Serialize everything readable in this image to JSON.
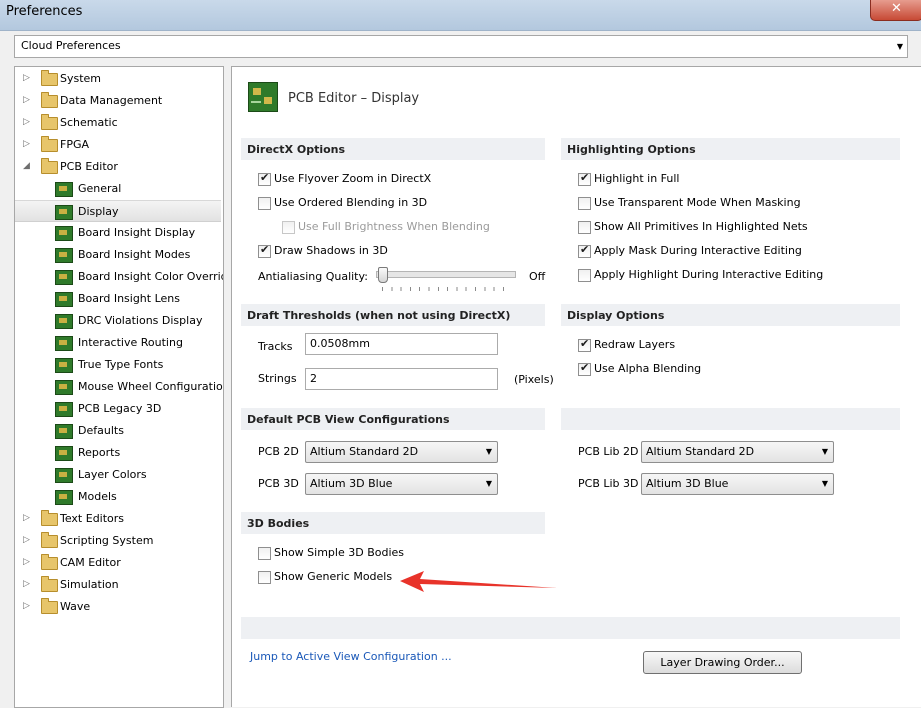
{
  "window": {
    "title": "Preferences",
    "close": "✕"
  },
  "cloud": {
    "value": "Cloud Preferences",
    "arrow": "▼"
  },
  "tree": [
    {
      "label": "System",
      "kind": "folder",
      "level": 0,
      "expanded": false,
      "selected": false
    },
    {
      "label": "Data Management",
      "kind": "folder",
      "level": 0,
      "expanded": false,
      "selected": false
    },
    {
      "label": "Schematic",
      "kind": "folder",
      "level": 0,
      "expanded": false,
      "selected": false
    },
    {
      "label": "FPGA",
      "kind": "folder",
      "level": 0,
      "expanded": false,
      "selected": false
    },
    {
      "label": "PCB Editor",
      "kind": "folder",
      "level": 0,
      "expanded": true,
      "selected": false
    },
    {
      "label": "General",
      "kind": "pcb",
      "level": 1,
      "selected": false
    },
    {
      "label": "Display",
      "kind": "pcb",
      "level": 1,
      "selected": true
    },
    {
      "label": "Board Insight Display",
      "kind": "pcb",
      "level": 1,
      "selected": false
    },
    {
      "label": "Board Insight Modes",
      "kind": "pcb",
      "level": 1,
      "selected": false
    },
    {
      "label": "Board Insight Color Overrid",
      "kind": "pcb",
      "level": 1,
      "selected": false
    },
    {
      "label": "Board Insight Lens",
      "kind": "pcb",
      "level": 1,
      "selected": false
    },
    {
      "label": "DRC Violations Display",
      "kind": "pcb",
      "level": 1,
      "selected": false
    },
    {
      "label": "Interactive Routing",
      "kind": "pcb",
      "level": 1,
      "selected": false
    },
    {
      "label": "True Type Fonts",
      "kind": "pcb",
      "level": 1,
      "selected": false
    },
    {
      "label": "Mouse Wheel Configuration",
      "kind": "pcb",
      "level": 1,
      "selected": false
    },
    {
      "label": "PCB Legacy 3D",
      "kind": "pcb",
      "level": 1,
      "selected": false
    },
    {
      "label": "Defaults",
      "kind": "pcb",
      "level": 1,
      "selected": false
    },
    {
      "label": "Reports",
      "kind": "pcb",
      "level": 1,
      "selected": false
    },
    {
      "label": "Layer Colors",
      "kind": "pcb",
      "level": 1,
      "selected": false
    },
    {
      "label": "Models",
      "kind": "pcb",
      "level": 1,
      "selected": false
    },
    {
      "label": "Text Editors",
      "kind": "folder",
      "level": 0,
      "expanded": false,
      "selected": false
    },
    {
      "label": "Scripting System",
      "kind": "folder",
      "level": 0,
      "expanded": false,
      "selected": false
    },
    {
      "label": "CAM Editor",
      "kind": "folder",
      "level": 0,
      "expanded": false,
      "selected": false
    },
    {
      "label": "Simulation",
      "kind": "folder",
      "level": 0,
      "expanded": false,
      "selected": false
    },
    {
      "label": "Wave",
      "kind": "folder",
      "level": 0,
      "expanded": false,
      "selected": false
    }
  ],
  "page": {
    "title": "PCB Editor – Display"
  },
  "directx": {
    "header": "DirectX Options",
    "flyover": {
      "label": "Use Flyover Zoom in DirectX",
      "checked": true
    },
    "ordered": {
      "label": "Use Ordered Blending in 3D",
      "checked": false
    },
    "brightness": {
      "label": "Use Full Brightness When Blending",
      "checked": false,
      "disabled": true
    },
    "shadows": {
      "label": "Draw Shadows in 3D",
      "checked": true
    },
    "antialias": {
      "label": "Antialiasing Quality:",
      "value_label": "Off",
      "level": 0
    }
  },
  "highlighting": {
    "header": "Highlighting Options",
    "full": {
      "label": "Highlight in Full",
      "checked": true
    },
    "transparent": {
      "label": "Use Transparent Mode When Masking",
      "checked": false
    },
    "primitives": {
      "label": "Show All Primitives In Highlighted Nets",
      "checked": false
    },
    "mask": {
      "label": "Apply Mask During Interactive Editing",
      "checked": true
    },
    "apply": {
      "label": "Apply Highlight During Interactive Editing",
      "checked": false
    }
  },
  "draft": {
    "header": "Draft Thresholds (when not using DirectX)",
    "tracks_label": "Tracks",
    "tracks_value": "0.0508mm",
    "strings_label": "Strings",
    "strings_value": "2",
    "strings_unit": "(Pixels)"
  },
  "display": {
    "header": "Display Options",
    "redraw": {
      "label": "Redraw Layers",
      "checked": true
    },
    "alpha": {
      "label": "Use Alpha Blending",
      "checked": true
    }
  },
  "views": {
    "header": "Default PCB View Configurations",
    "pcb2d_label": "PCB 2D",
    "pcb2d_value": "Altium Standard 2D",
    "pcb3d_label": "PCB 3D",
    "pcb3d_value": "Altium 3D Blue",
    "lib2d_label": "PCB Lib 2D",
    "lib2d_value": "Altium Standard 2D",
    "lib3d_label": "PCB Lib 3D",
    "lib3d_value": "Altium 3D Blue"
  },
  "bodies": {
    "header": "3D Bodies",
    "simple": {
      "label": "Show Simple 3D Bodies",
      "checked": false
    },
    "generic": {
      "label": "Show Generic Models",
      "checked": false
    }
  },
  "footer": {
    "link": "Jump to Active View Configuration ...",
    "layer_button": "Layer Drawing Order..."
  },
  "colors": {
    "annotation_arrow": "#e8332a",
    "link": "#1a58b8"
  }
}
